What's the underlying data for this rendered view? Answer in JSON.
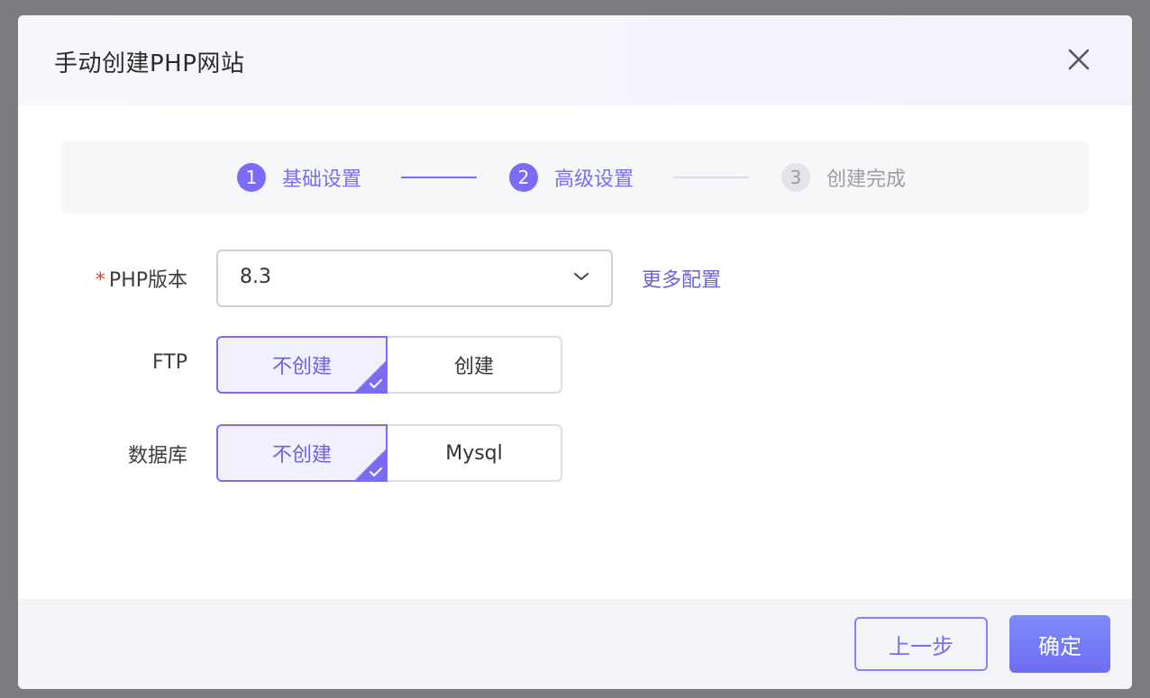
{
  "dialog": {
    "title": "手动创建PHP网站",
    "close_icon": "close-icon"
  },
  "steps": [
    {
      "num": "1",
      "label": "基础设置",
      "state": "done"
    },
    {
      "num": "2",
      "label": "高级设置",
      "state": "current"
    },
    {
      "num": "3",
      "label": "创建完成",
      "state": "pending"
    }
  ],
  "form": {
    "php_version": {
      "required_mark": "*",
      "label": "PHP版本",
      "value": "8.3",
      "more_link": "更多配置"
    },
    "ftp": {
      "label": "FTP",
      "options": [
        "不创建",
        "创建"
      ],
      "selected": "不创建"
    },
    "database": {
      "label": "数据库",
      "options": [
        "不创建",
        "Mysql"
      ],
      "selected": "不创建"
    }
  },
  "footer": {
    "prev_label": "上一步",
    "ok_label": "确定"
  },
  "colors": {
    "accent": "#7b6cf6",
    "required": "#e23b3b",
    "overlay": "#7a7c80"
  }
}
